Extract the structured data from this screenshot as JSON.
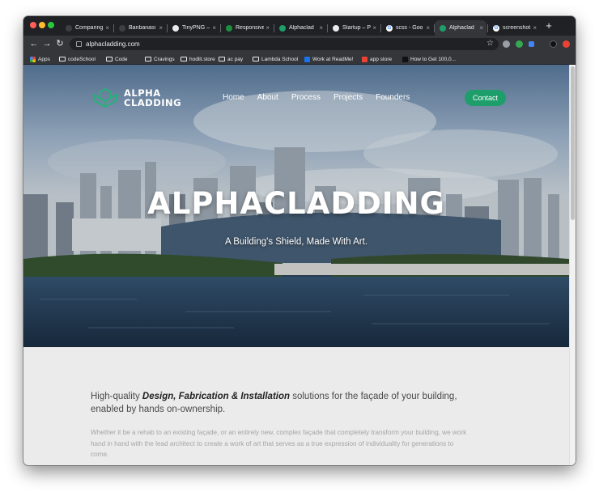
{
  "browser": {
    "tabs": [
      {
        "title": "Comparing",
        "fav_color": "#3c4043",
        "fav_glyph": "",
        "active": false
      },
      {
        "title": "Banbanasi",
        "fav_color": "#3c4043",
        "fav_glyph": "",
        "active": false
      },
      {
        "title": "TinyPNG –",
        "fav_color": "#e8eaed",
        "fav_glyph": "",
        "active": false
      },
      {
        "title": "Responsive",
        "fav_color": "#1e8e3e",
        "fav_glyph": "",
        "active": false
      },
      {
        "title": "Alphaclad",
        "fav_color": "#1e9e6b",
        "fav_glyph": "",
        "active": false
      },
      {
        "title": "Startup – P",
        "fav_color": "#e8eaed",
        "fav_glyph": "",
        "active": false
      },
      {
        "title": "scss - Goo",
        "fav_color": "#ffffff",
        "fav_glyph": "G",
        "active": false
      },
      {
        "title": "Alphaclad",
        "fav_color": "#1e9e6b",
        "fav_glyph": "",
        "active": true
      },
      {
        "title": "screenshot",
        "fav_color": "#ffffff",
        "fav_glyph": "G",
        "active": false
      }
    ],
    "new_tab": "+",
    "url": "alphacladding.com",
    "bookmarks": [
      {
        "label": "Apps",
        "kind": "apps"
      },
      {
        "label": "codeSchool",
        "kind": "folder"
      },
      {
        "label": "Code",
        "kind": "folder"
      },
      {
        "label": "Cravings",
        "kind": "folder"
      },
      {
        "label": "hodlit.store",
        "kind": "folder"
      },
      {
        "label": "ac pay",
        "kind": "folder"
      },
      {
        "label": "Lambda School",
        "kind": "folder"
      },
      {
        "label": "Work at ReadMe!",
        "kind": "page"
      },
      {
        "label": "app store",
        "kind": "page"
      },
      {
        "label": "How to Get 100,0...",
        "kind": "page"
      }
    ]
  },
  "site": {
    "logo": {
      "line1": "ALPHA",
      "line2": "CLADDING"
    },
    "nav": [
      "Home",
      "About",
      "Process",
      "Projects",
      "Founders"
    ],
    "contact_label": "Contact",
    "hero_title": "ALPHACLADDING",
    "hero_subtitle": "A Building's Shield, Made With Art.",
    "lead_before": "High-quality ",
    "lead_em": "Design, Fabrication & Installation",
    "lead_after": " solutions for the façade of your building, enabled by hands on-ownership.",
    "body": "Whether it be a rehab to an existing façade, or an entirely new, complex façade that completely transform your building, we work hand in hand with the lead architect to create a work of art that serves as a true expression of individuality for generations to come.",
    "accent_color": "#1e9e6b"
  }
}
